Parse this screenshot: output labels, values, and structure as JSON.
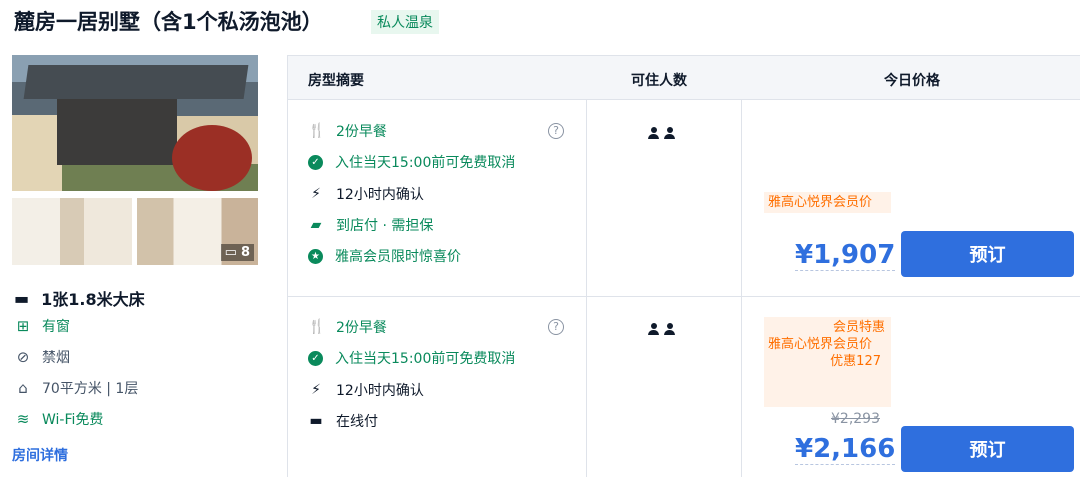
{
  "room": {
    "title": "麓房一居别墅（含1个私汤泡池）",
    "tag": "私人温泉",
    "photo_count": "8",
    "bed": "1张1.8米大床",
    "features": [
      {
        "icon": "window-icon",
        "label": "有窗"
      },
      {
        "icon": "no-smoking-icon",
        "label": "禁烟"
      },
      {
        "icon": "area-icon",
        "label": "70平方米 | 1层"
      },
      {
        "icon": "wifi-icon",
        "label": "Wi-Fi免费"
      }
    ],
    "detail_link": "房间详情"
  },
  "table": {
    "headers": [
      "房型摘要",
      "可住人数",
      "今日价格"
    ]
  },
  "offers": [
    {
      "policies": [
        "2份早餐",
        "入住当天15:00前可免费取消",
        "12小时内确认",
        "到店付 · 需担保",
        "雅高会员限时惊喜价"
      ],
      "guest_count": 2,
      "promo_label": "雅高心悦界会员价",
      "price": "¥1,907",
      "book_label": "预订"
    },
    {
      "policies": [
        "2份早餐",
        "入住当天15:00前可免费取消",
        "12小时内确认",
        "在线付"
      ],
      "guest_count": 2,
      "promo_tag": "会员特惠",
      "promo_label": "雅高心悦界会员价",
      "discount": "优惠127",
      "original_price": "¥2,293",
      "price": "¥2,166",
      "book_label": "预订"
    }
  ],
  "colors": {
    "accent_blue": "#2f6fde",
    "green": "#0a8a5c",
    "promo_orange": "#ff6f00"
  }
}
